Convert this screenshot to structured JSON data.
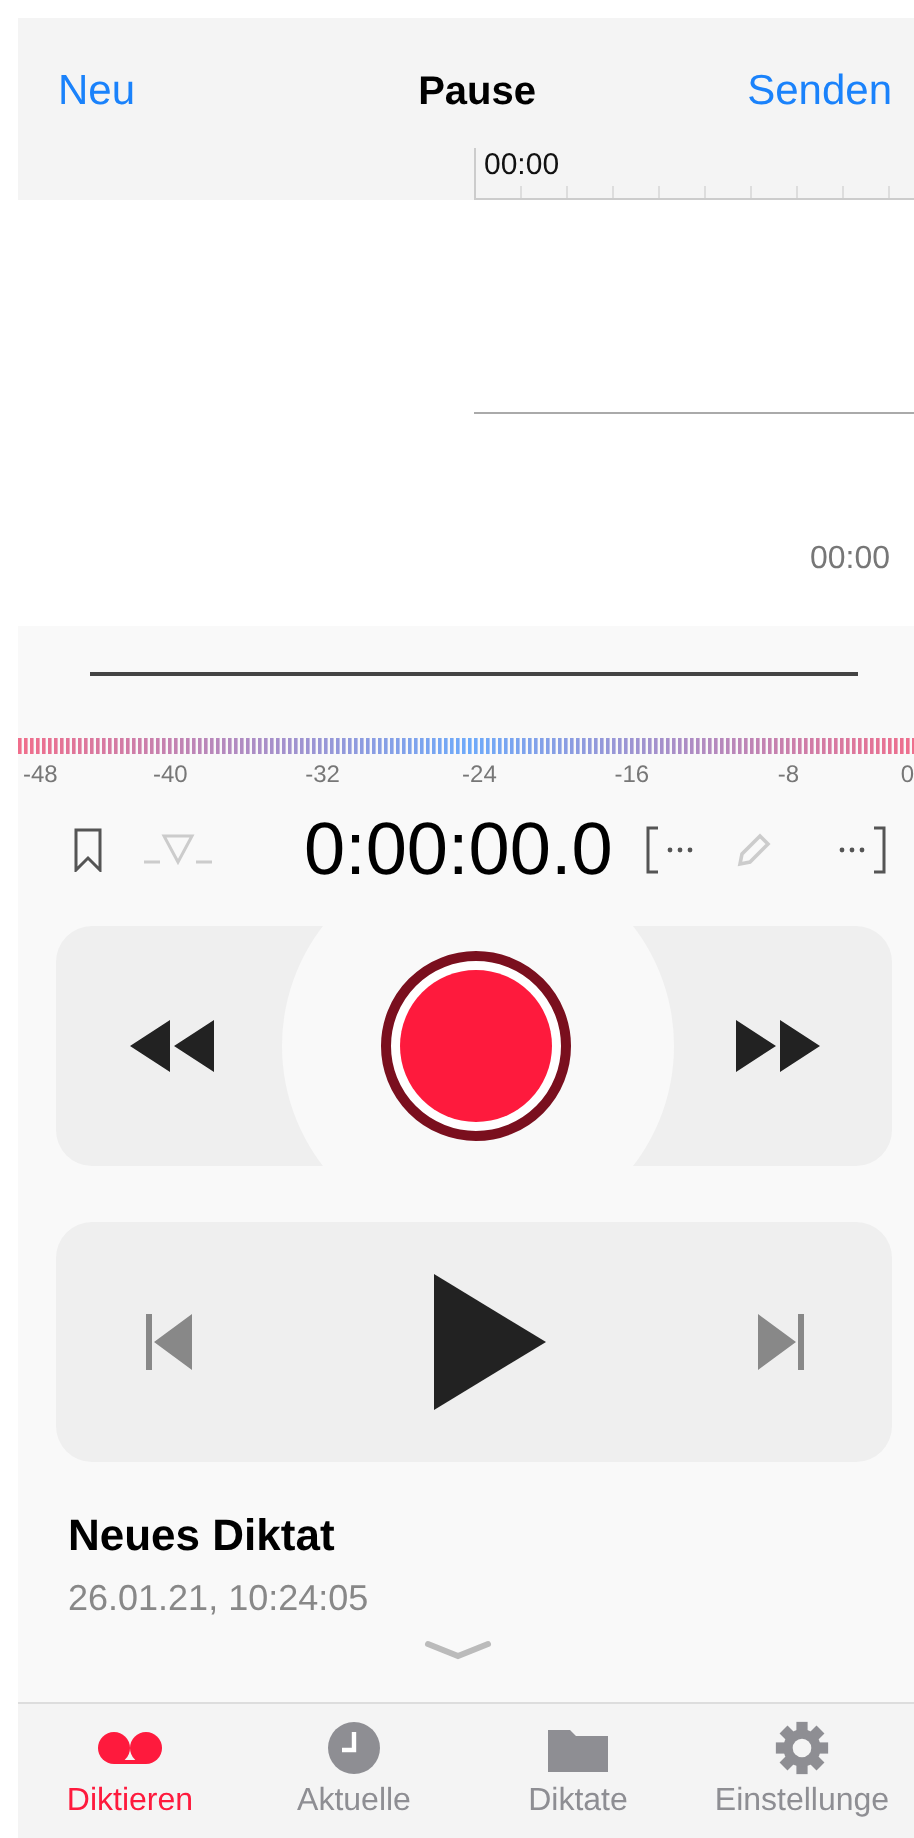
{
  "nav": {
    "left": "Neu",
    "title": "Pause",
    "right": "Senden"
  },
  "timeline": {
    "start_label": "00:00",
    "end_label": "00:00"
  },
  "meter": {
    "scale": [
      "-48",
      "-40",
      "-32",
      "-24",
      "-16",
      "-8",
      "0"
    ]
  },
  "counter": "0:00:00.0",
  "dictation": {
    "title": "Neues Diktat",
    "date": "26.01.21, 10:24:05"
  },
  "tabs": [
    {
      "label": "Diktieren",
      "selected": true
    },
    {
      "label": "Aktuelle",
      "selected": false
    },
    {
      "label": "Diktate",
      "selected": false
    },
    {
      "label": "Einstellunge",
      "selected": false
    }
  ]
}
